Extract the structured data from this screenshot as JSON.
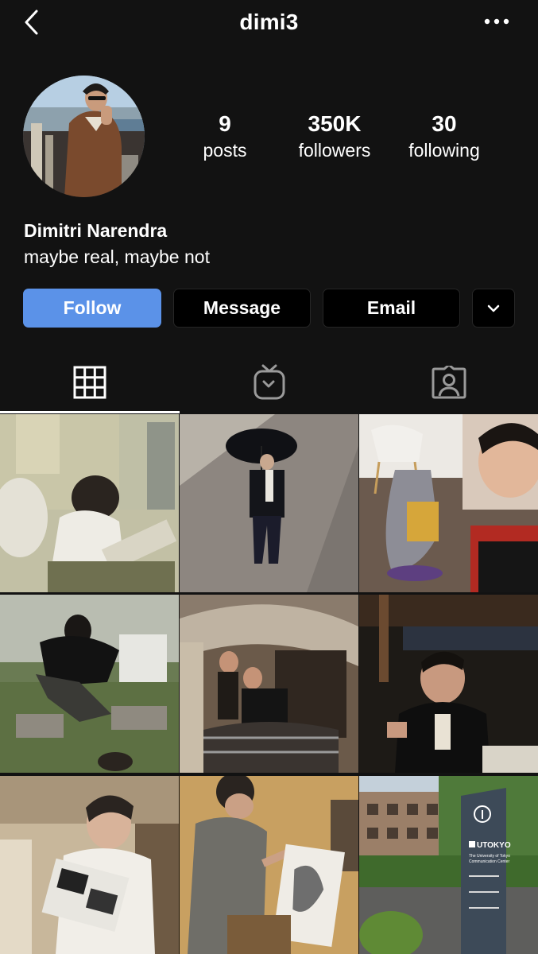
{
  "header": {
    "username": "dimi3",
    "back_icon": "chevron-left-icon",
    "more_icon": "more-horizontal-icon"
  },
  "profile": {
    "stats": [
      {
        "value": "9",
        "label": "posts"
      },
      {
        "value": "350K",
        "label": "followers"
      },
      {
        "value": "30",
        "label": "following"
      }
    ],
    "display_name": "Dimitri Narendra",
    "bio": "maybe real, maybe not"
  },
  "actions": {
    "follow_label": "Follow",
    "message_label": "Message",
    "email_label": "Email",
    "dropdown_icon": "chevron-down-icon"
  },
  "tabs": [
    {
      "name": "grid",
      "icon": "grid-icon",
      "active": true
    },
    {
      "name": "igtv",
      "icon": "tv-icon",
      "active": false
    },
    {
      "name": "tagged",
      "icon": "tagged-user-icon",
      "active": false
    }
  ],
  "posts": {
    "count": 9,
    "signage": {
      "brand": "UTOKYO",
      "subtitle": "The University of Tokyo",
      "subtitle2": "Communication Center"
    }
  },
  "colors": {
    "background": "#121212",
    "follow_button": "#5b92e8",
    "secondary_button": "#000000"
  }
}
